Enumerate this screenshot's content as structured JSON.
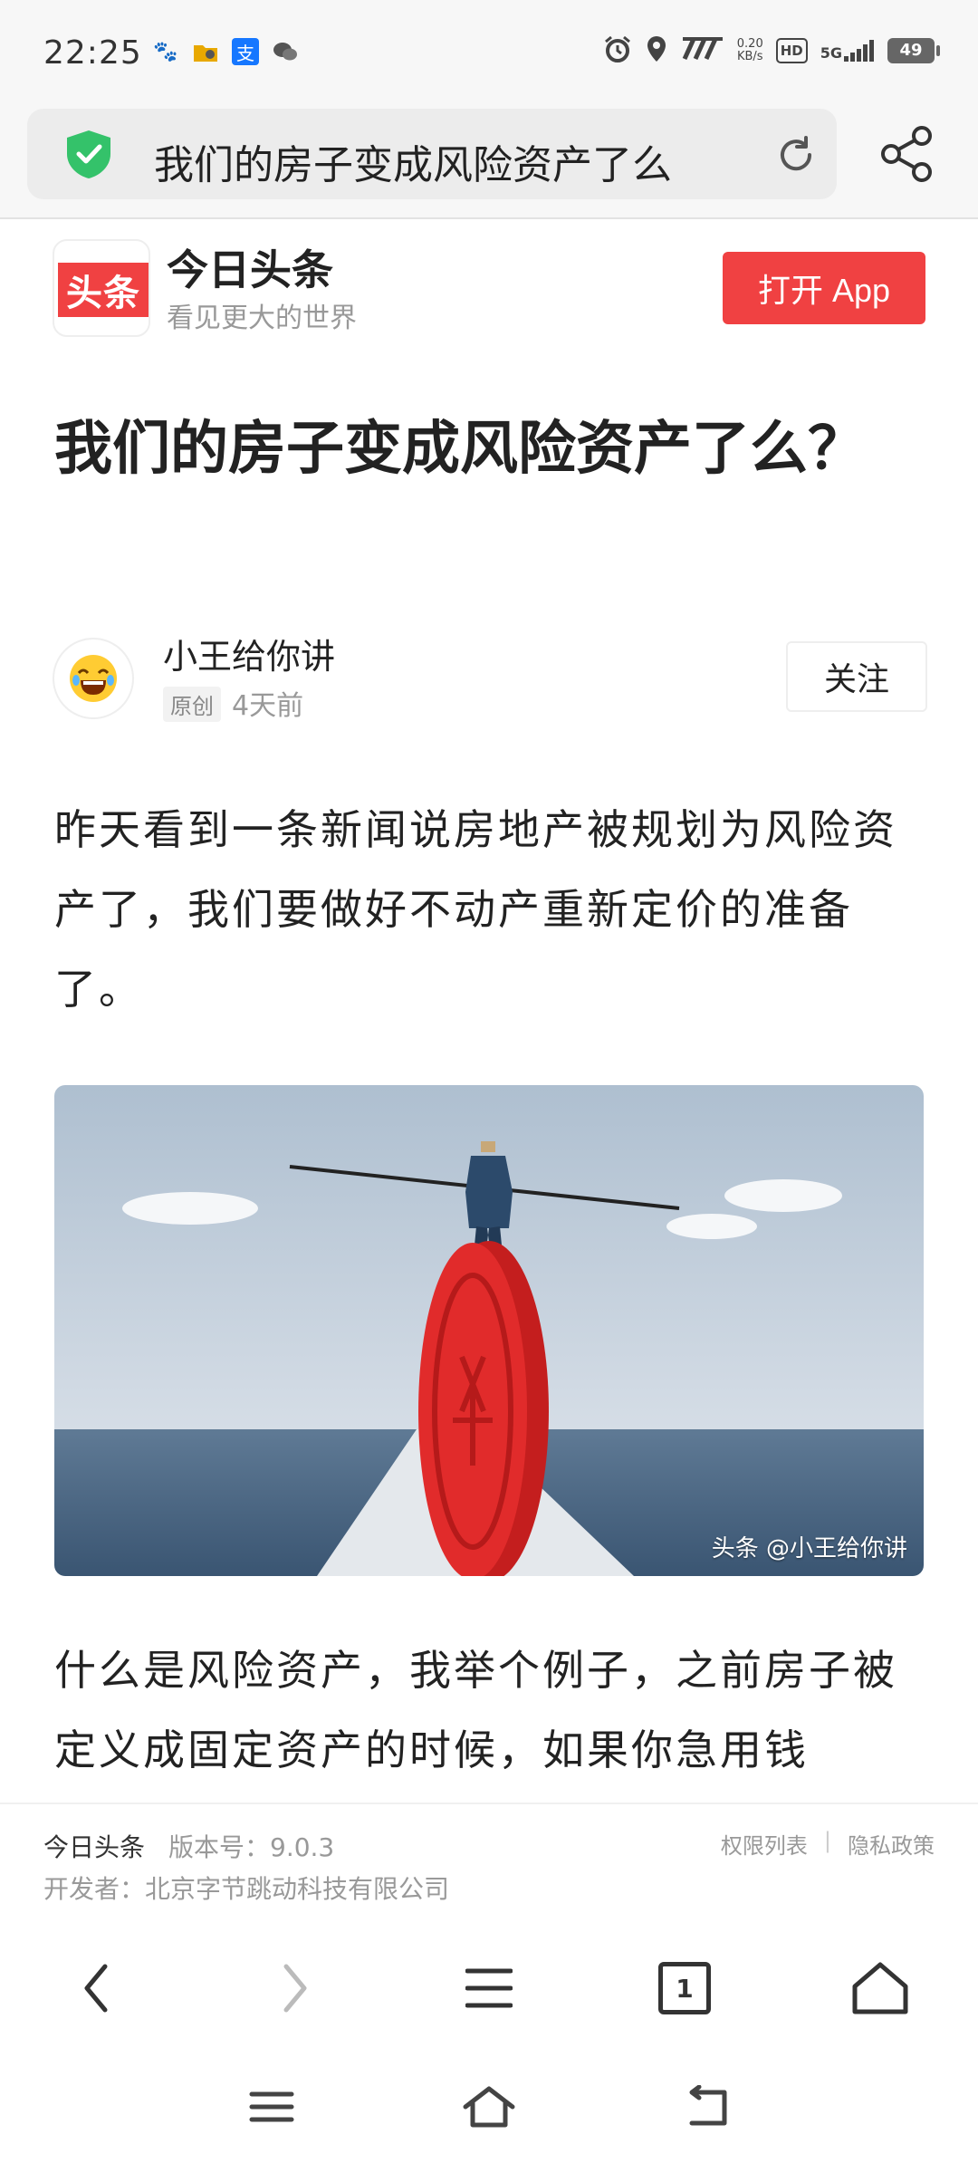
{
  "status_bar": {
    "time": "22:25",
    "network_speed_value": "0.20",
    "network_speed_unit": "KB/s",
    "hd_label": "HD",
    "network_type": "5G",
    "battery_level": "49",
    "icons": [
      "paw-icon",
      "file-icon",
      "alipay-icon",
      "wechat-icon",
      "alarm-icon",
      "location-icon",
      "signal-icon"
    ]
  },
  "address_bar": {
    "url_text": "我们的房子变成风险资产了么"
  },
  "app_banner": {
    "logo_text": "头条",
    "app_name": "今日头条",
    "slogan": "看见更大的世界",
    "open_button": "打开 App"
  },
  "article": {
    "title": "我们的房子变成风险资产了么？",
    "author": "小王给你讲",
    "original_badge": "原创",
    "time_ago": "4天前",
    "follow_button": "关注",
    "paragraph_1": "昨天看到一条新闻说房地产被规划为风险资产了，我们要做好不动产重新定价的准备了。",
    "image_credit": "头条 @小王给你讲",
    "paragraph_2": "什么是风险资产，我举个例子，之前房子被定义成固定资产的时候，如果你急用钱"
  },
  "footer_info": {
    "app_name": "今日头条",
    "version": "版本号：9.0.3",
    "developer": "开发者：北京字节跳动科技有限公司",
    "permissions_link": "权限列表",
    "separator": "|",
    "privacy_link": "隐私政策"
  },
  "toolbar": {
    "tab_count": "1"
  },
  "colors": {
    "brand_red": "#f04142",
    "shield_green": "#34c26a"
  }
}
